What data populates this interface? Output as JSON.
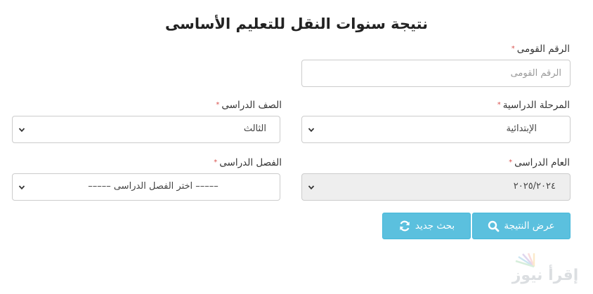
{
  "title": "نتيجة سنوات النقل للتعليم الأساسى",
  "national_id": {
    "label": "الرقم القومى",
    "placeholder": "الرقم القومى",
    "value": ""
  },
  "stage": {
    "label": "المرحلة الدراسية",
    "selected": "الإبتدائية"
  },
  "grade": {
    "label": "الصف الدراسى",
    "selected": "الثالث"
  },
  "year": {
    "label": "العام الدراسى",
    "selected": "٢٠٢٥/٢٠٢٤"
  },
  "term": {
    "label": "الفصل الدراسى",
    "selected": "–––––  اختر الفصل الدراسى  –––––"
  },
  "buttons": {
    "show_result": "عرض النتيجة",
    "new_search": "بحث جديد"
  },
  "required_mark": "*",
  "watermark_text": "إقرأ نيوز",
  "colors": {
    "button": "#5bc0de",
    "required": "#d9534f",
    "disabled_bg": "#eeeeee"
  },
  "icons": {
    "show_result": "search-icon",
    "new_search": "refresh-icon",
    "select": "chevron-down-icon"
  }
}
